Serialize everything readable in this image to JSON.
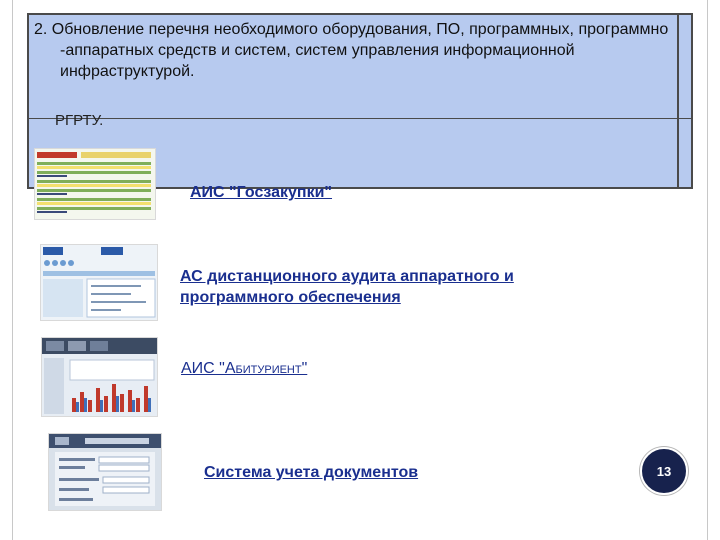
{
  "item": {
    "line1": "2. Обновление перечня необходимого оборудования, ПО, программных, программно",
    "line2": "-аппаратных средств и систем, систем управления информационной",
    "line3": "инфраструктурой.",
    "subtext": "РГРТУ."
  },
  "links": [
    {
      "label": "АИС \"Госзакупки\"",
      "icon": "spreadsheet-screenshot"
    },
    {
      "label": "АС дистанционного аудита аппаратного и программного обеспечения",
      "icon": "ocs-inventory-screenshot"
    },
    {
      "label": "АИС \"Абитуриент\"",
      "icon": "admissions-dashboard-screenshot"
    },
    {
      "label": "Система учета документов",
      "icon": "document-system-screenshot"
    }
  ],
  "page_number": "13",
  "colors": {
    "box_fill": "#b7caef",
    "link": "#1a2f8f",
    "page_badge": "#17224d"
  }
}
